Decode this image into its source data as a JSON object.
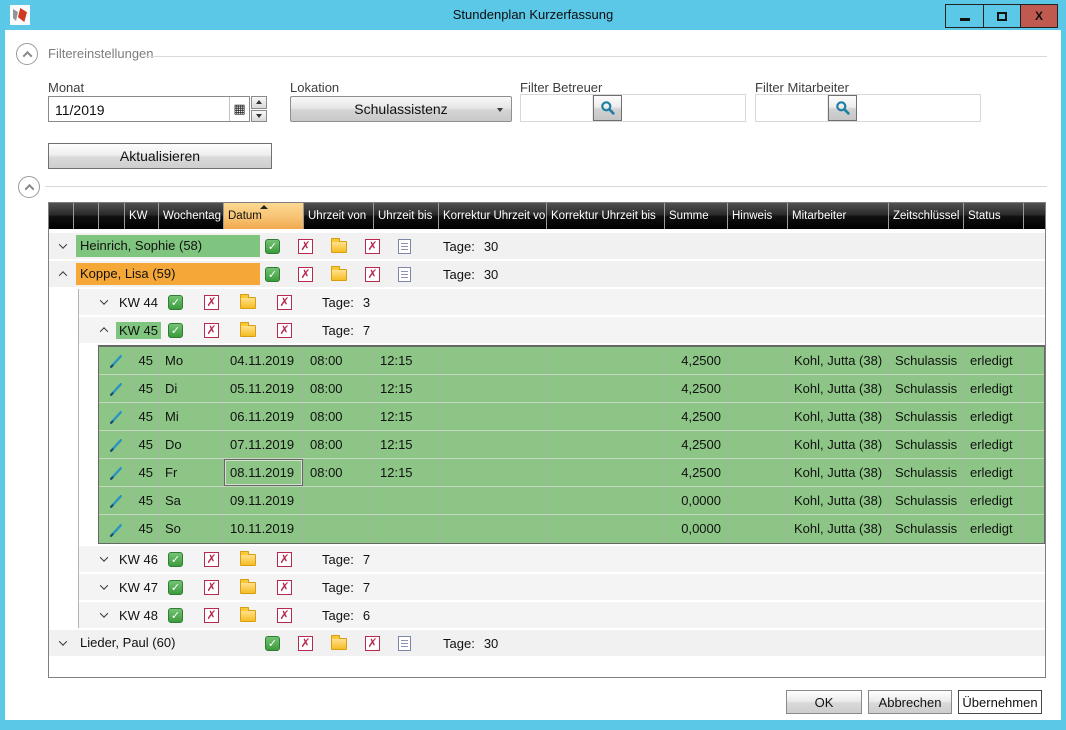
{
  "window": {
    "title": "Stundenplan Kurzerfassung",
    "controls": {
      "close_glyph": "X"
    }
  },
  "filters": {
    "section_label": "Filtereinstellungen",
    "monat": {
      "label": "Monat",
      "value": "11/2019"
    },
    "lokation": {
      "label": "Lokation",
      "value": "Schulassistenz"
    },
    "filter_betreuer": {
      "label": "Filter Betreuer",
      "value": ""
    },
    "filter_mitarbeiter": {
      "label": "Filter Mitarbeiter",
      "value": ""
    },
    "refresh_label": "Aktualisieren"
  },
  "table": {
    "columns": [
      "",
      "",
      "",
      "KW",
      "Wochentag",
      "Datum",
      "Uhrzeit von",
      "Uhrzeit bis",
      "Korrektur Uhrzeit von",
      "Korrektur Uhrzeit bis",
      "Summe",
      "Hinweis",
      "Mitarbeiter",
      "Zeitschlüssel",
      "Status",
      ""
    ],
    "sort": {
      "column": "Datum",
      "direction": "asc"
    },
    "groups": [
      {
        "name": "Heinrich, Sophie (58)",
        "highlight": "green",
        "tage_label": "Tage:",
        "tage": "30",
        "expanded": false
      },
      {
        "name": "Koppe, Lisa (59)",
        "highlight": "orange",
        "tage_label": "Tage:",
        "tage": "30",
        "expanded": true,
        "weeks": [
          {
            "label": "KW 44",
            "tage_label": "Tage:",
            "tage": "3",
            "expanded": false
          },
          {
            "label": "KW 45",
            "tage_label": "Tage:",
            "tage": "7",
            "expanded": true,
            "highlighted": true,
            "days": [
              {
                "kw": "45",
                "wochentag": "Mo",
                "datum": "04.11.2019",
                "uhrzeit_von": "08:00",
                "uhrzeit_bis": "12:15",
                "korrektur_von": "",
                "korrektur_bis": "",
                "summe": "4,2500",
                "hinweis": "",
                "mitarbeiter": "Kohl, Jutta (38)",
                "zeitschluessel": "Schulassis",
                "status": "erledigt"
              },
              {
                "kw": "45",
                "wochentag": "Di",
                "datum": "05.11.2019",
                "uhrzeit_von": "08:00",
                "uhrzeit_bis": "12:15",
                "korrektur_von": "",
                "korrektur_bis": "",
                "summe": "4,2500",
                "hinweis": "",
                "mitarbeiter": "Kohl, Jutta (38)",
                "zeitschluessel": "Schulassis",
                "status": "erledigt"
              },
              {
                "kw": "45",
                "wochentag": "Mi",
                "datum": "06.11.2019",
                "uhrzeit_von": "08:00",
                "uhrzeit_bis": "12:15",
                "korrektur_von": "",
                "korrektur_bis": "",
                "summe": "4,2500",
                "hinweis": "",
                "mitarbeiter": "Kohl, Jutta (38)",
                "zeitschluessel": "Schulassis",
                "status": "erledigt"
              },
              {
                "kw": "45",
                "wochentag": "Do",
                "datum": "07.11.2019",
                "uhrzeit_von": "08:00",
                "uhrzeit_bis": "12:15",
                "korrektur_von": "",
                "korrektur_bis": "",
                "summe": "4,2500",
                "hinweis": "",
                "mitarbeiter": "Kohl, Jutta (38)",
                "zeitschluessel": "Schulassis",
                "status": "erledigt"
              },
              {
                "kw": "45",
                "wochentag": "Fr",
                "datum": "08.11.2019",
                "uhrzeit_von": "08:00",
                "uhrzeit_bis": "12:15",
                "korrektur_von": "",
                "korrektur_bis": "",
                "summe": "4,2500",
                "hinweis": "",
                "mitarbeiter": "Kohl, Jutta (38)",
                "zeitschluessel": "Schulassis",
                "status": "erledigt",
                "selected_cell": "datum"
              },
              {
                "kw": "45",
                "wochentag": "Sa",
                "datum": "09.11.2019",
                "uhrzeit_von": "",
                "uhrzeit_bis": "",
                "korrektur_von": "",
                "korrektur_bis": "",
                "summe": "0,0000",
                "hinweis": "",
                "mitarbeiter": "Kohl, Jutta (38)",
                "zeitschluessel": "Schulassis",
                "status": "erledigt"
              },
              {
                "kw": "45",
                "wochentag": "So",
                "datum": "10.11.2019",
                "uhrzeit_von": "",
                "uhrzeit_bis": "",
                "korrektur_von": "",
                "korrektur_bis": "",
                "summe": "0,0000",
                "hinweis": "",
                "mitarbeiter": "Kohl, Jutta (38)",
                "zeitschluessel": "Schulassis",
                "status": "erledigt"
              }
            ]
          },
          {
            "label": "KW 46",
            "tage_label": "Tage:",
            "tage": "7",
            "expanded": false
          },
          {
            "label": "KW 47",
            "tage_label": "Tage:",
            "tage": "7",
            "expanded": false
          },
          {
            "label": "KW 48",
            "tage_label": "Tage:",
            "tage": "6",
            "expanded": false
          }
        ]
      },
      {
        "name": "Lieder, Paul (60)",
        "highlight": "none",
        "tage_label": "Tage:",
        "tage": "30",
        "expanded": false
      }
    ]
  },
  "footer": {
    "ok_label": "OK",
    "cancel_label": "Abbrechen",
    "apply_label": "Übernehmen"
  },
  "colors": {
    "titlebar": "#5bc8e8",
    "close_button": "#c05a50",
    "header_bg": "#1e1e1e",
    "sorted_header_orange": "#f6c271",
    "row_green": "#8dc586",
    "person_green": "#7fc57f",
    "person_orange": "#f5a838",
    "icon_green": "#3c9b3c",
    "icon_red": "#b7284c",
    "icon_yellow": "#f6bd23",
    "pencil_teal": "#2b94c0",
    "search_teal": "#1d7fa3"
  }
}
